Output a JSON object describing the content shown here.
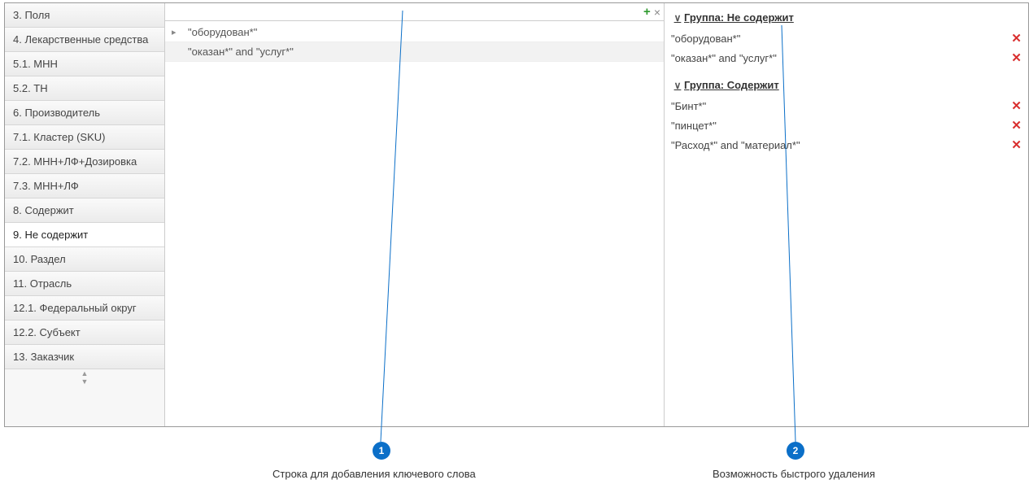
{
  "sidebar": {
    "items": [
      {
        "label": "3. Поля",
        "active": false
      },
      {
        "label": "4. Лекарственные средства",
        "active": false
      },
      {
        "label": "5.1. МНН",
        "active": false
      },
      {
        "label": "5.2. ТН",
        "active": false
      },
      {
        "label": "6. Производитель",
        "active": false
      },
      {
        "label": "7.1. Кластер (SKU)",
        "active": false
      },
      {
        "label": "7.2. МНН+ЛФ+Дозировка",
        "active": false
      },
      {
        "label": "7.3. МНН+ЛФ",
        "active": false
      },
      {
        "label": "8. Содержит",
        "active": false
      },
      {
        "label": "9. Не содержит",
        "active": true
      },
      {
        "label": "10. Раздел",
        "active": false
      },
      {
        "label": "11. Отрасль",
        "active": false
      },
      {
        "label": "12.1. Федеральный округ",
        "active": false
      },
      {
        "label": "12.2. Субъект",
        "active": false
      },
      {
        "label": "13. Заказчик",
        "active": false
      }
    ]
  },
  "middle": {
    "rows": [
      {
        "text": "\"оборудован*\"",
        "has_arrow": true,
        "alt": false
      },
      {
        "text": "\"оказан*\" and \"услуг*\"",
        "has_arrow": false,
        "alt": true
      }
    ]
  },
  "right": {
    "groups": [
      {
        "title": "Группа: Не содержит",
        "rules": [
          {
            "text": "\"оборудован*\""
          },
          {
            "text": "\"оказан*\" and \"услуг*\""
          }
        ]
      },
      {
        "title": "Группа: Содержит",
        "rules": [
          {
            "text": "\"Бинт*\""
          },
          {
            "text": "\"пинцет*\""
          },
          {
            "text": "\"Расход*\" and \"материал*\""
          }
        ]
      }
    ]
  },
  "callouts": {
    "c1": {
      "num": "1",
      "caption": "Строка для добавления ключевого слова"
    },
    "c2": {
      "num": "2",
      "caption": "Возможность быстрого удаления"
    }
  }
}
